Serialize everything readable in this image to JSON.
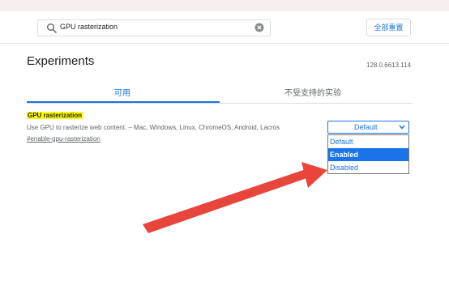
{
  "header": {
    "search": {
      "value": "GPU rasterization",
      "placeholder": "Search flags"
    },
    "reset_label": "全部重置"
  },
  "page": {
    "title": "Experiments",
    "version": "128.0.6613.114"
  },
  "tabs": [
    {
      "label": "可用",
      "active": true
    },
    {
      "label": "不受支持的实验",
      "active": false
    }
  ],
  "experiment": {
    "name": "GPU rasterization",
    "description": "Use GPU to rasterize web content. – Mac, Windows, Linux, ChromeOS, Android, Lacros",
    "link": "#enable-gpu-rasterization",
    "selected": "Default",
    "options": [
      "Default",
      "Enabled",
      "Disabled"
    ],
    "highlighted_option": "Enabled"
  },
  "colors": {
    "accent": "#1a73e8",
    "highlight": "#ffff00",
    "arrow": "#e8453c"
  },
  "icons": {
    "search": "search-icon",
    "clear": "clear-icon",
    "dropdown": "chevron-down-icon",
    "annotation": "arrow-icon"
  }
}
